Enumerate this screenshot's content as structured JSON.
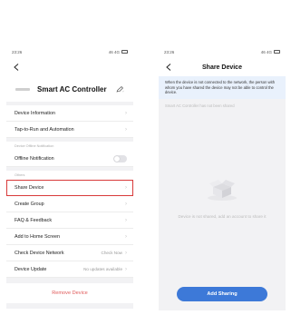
{
  "left_screen": {
    "status_time": "23:26",
    "status_icons_text": "46 4G",
    "device_name": "Smart AC Controller",
    "rows_group1": [
      {
        "label": "Device Information"
      },
      {
        "label": "Tap-to-Run and Automation"
      }
    ],
    "offline_section_label": "Device Offline Notification",
    "offline_row": {
      "label": "Offline Notification"
    },
    "others_section_label": "Others",
    "rows_group2": [
      {
        "label": "Share Device",
        "value": ""
      },
      {
        "label": "Create Group",
        "value": ""
      },
      {
        "label": "FAQ & Feedback",
        "value": ""
      },
      {
        "label": "Add to Home Screen",
        "value": ""
      },
      {
        "label": "Check Device Network",
        "value": "Check Now"
      },
      {
        "label": "Device Update",
        "value": "No updates available"
      }
    ],
    "remove_label": "Remove Device",
    "colors": {
      "highlight": "#d83a3a",
      "remove": "#e05a5a"
    }
  },
  "right_screen": {
    "status_time": "23:26",
    "status_icons_text": "46 4G",
    "title": "Share Device",
    "info_text": "When the device is not connected to the network, the person with whom you have shared the device may not be able to control the device.",
    "shared_status": "Smart AC Controller has not been shared",
    "empty_message": "Device is not shared, add an account to share it",
    "add_button_label": "Add Sharing",
    "colors": {
      "button": "#3d79d8",
      "info_bg": "#e9f1fc"
    }
  }
}
